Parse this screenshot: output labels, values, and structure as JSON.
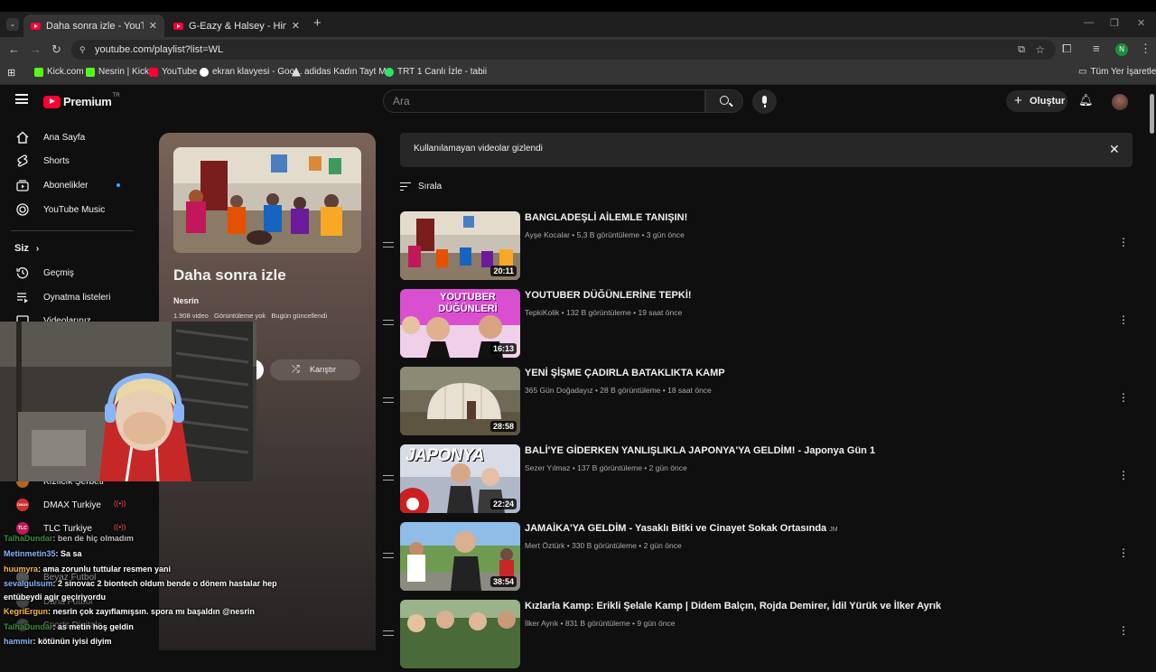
{
  "browser": {
    "tabs": [
      {
        "title": "Daha sonra izle - YouTube",
        "active": true
      },
      {
        "title": "G-Eazy & Halsey - Him & I (Lyri",
        "active": false
      }
    ],
    "new_tab_label": "+",
    "url": "youtube.com/playlist?list=WL",
    "profile_initial": "N",
    "bookmarks": [
      {
        "label": "Kick.com",
        "color": "#53fc18"
      },
      {
        "label": "Nesrin | Kick",
        "color": "#53fc18"
      },
      {
        "label": "YouTube",
        "color": "#ff0033"
      },
      {
        "label": "ekran klavyesi - Goo...",
        "color": "#ffffff"
      },
      {
        "label": "adidas Kadın Tayt M...",
        "color": "#dddddd"
      },
      {
        "label": "TRT 1 Canlı İzle - tabii",
        "color": "#2fe36b"
      }
    ],
    "all_bookmarks": "Tüm Yer İşaretleri"
  },
  "yt": {
    "logo_text": "Premium",
    "logo_region": "TR",
    "search_placeholder": "Ara",
    "create_label": "Oluştur",
    "sidebar": {
      "main": [
        {
          "label": "Ana Sayfa",
          "icon": "home-icon"
        },
        {
          "label": "Shorts",
          "icon": "shorts-icon"
        },
        {
          "label": "Abonelikler",
          "icon": "subscriptions-icon"
        },
        {
          "label": "YouTube Music",
          "icon": "music-icon"
        }
      ],
      "you_heading": "Siz",
      "you": [
        {
          "label": "Geçmiş",
          "icon": "history-icon"
        },
        {
          "label": "Oynatma listeleri",
          "icon": "playlists-icon"
        },
        {
          "label": "Videolarınız",
          "icon": "your-videos-icon"
        }
      ],
      "channels": [
        {
          "label": "Kızılcık Şerbeti",
          "color": "#b5651d"
        },
        {
          "label": "DMAX Turkiye",
          "color": "#d32f2f"
        },
        {
          "label": "TLC Turkiye",
          "color": "#c2185b"
        }
      ],
      "channels_hidden": [
        "Beyaz Futbol",
        "Daha Futbol",
        "Sports Digitale"
      ]
    },
    "playlist": {
      "title": "Daha sonra izle",
      "owner": "Nesrin",
      "stats": "1.908 video   Görüntüleme yok   Bugün güncellendi",
      "shuffle_label": "Karıştır"
    },
    "banner_text": "Kullanılamayan videolar gizlendi",
    "sort_label": "Sırala",
    "videos": [
      {
        "title": "BANGLADEŞLİ AİLEMLE TANIŞIN!",
        "meta": "Ayşe Kocalar • 5,3 B görüntüleme • 3 gün önce",
        "duration": "20:11"
      },
      {
        "title": "YOUTUBER DÜĞÜNLERİNE TEPKİ!",
        "meta": "TepkiKolik • 132 B görüntüleme • 19 saat önce",
        "duration": "16:13"
      },
      {
        "title": "YENİ ŞİŞME ÇADIRLA BATAKLIKTA KAMP",
        "meta": "365 Gün Doğadayız • 28 B görüntüleme • 18 saat önce",
        "duration": "28:58"
      },
      {
        "title": "BALİ'YE GİDERKEN YANLIŞLIKLA JAPONYA'YA GELDİM! - Japonya Gün 1",
        "meta": "Sezer Yılmaz • 137 B görüntüleme • 2 gün önce",
        "duration": "22:24"
      },
      {
        "title": "JAMAİKA'YA GELDİM - Yasaklı Bitki ve Cinayet Sokak Ortasında",
        "title_suffix": "JM",
        "meta": "Mert Öztürk • 330 B görüntüleme • 2 gün önce",
        "duration": "38:54"
      },
      {
        "title": "Kızlarla Kamp: Erikli Şelale Kamp | Didem Balçın, Rojda Demirer, İdil Yürük ve İlker Ayrık",
        "meta": "İlker Ayrık • 831 B görüntüleme • 9 gün önce",
        "duration": ""
      }
    ],
    "thumb_texts": {
      "v2": "YOUTUBER DÜĞÜNLERİ",
      "v4": "JAPONYA"
    }
  },
  "chat": [
    {
      "user": "TalhaDundar",
      "msg": ": ben de hiç olmadım",
      "color": "#3b8e3b"
    },
    {
      "user": "Metinmetin35",
      "msg": ": Sa sa",
      "color": "#8ab4f8"
    },
    {
      "user": "huumyra",
      "msg": ": ama zorunlu tuttular resmen yani",
      "color": "#ffb74d"
    },
    {
      "user": "sevalgulsum",
      "msg": ": 2 sinovac 2 biontech oldum bende o dönem hastalar hep",
      "color": "#8ab4f8"
    },
    {
      "user": "",
      "msg": "entübeydi agir geçiriyordu",
      "color": "#ffffff"
    },
    {
      "user": "KegriErgun",
      "msg": ": nesrin çok zayıflamışsın. spora mı başaldın @nesrin",
      "color": "#ffb74d"
    },
    {
      "user": "TalhaDundar",
      "msg": ": as metin hoş geldin",
      "color": "#3b8e3b"
    },
    {
      "user": "hammir",
      "msg": ": kötünün iyisi diyim",
      "color": "#8ab4f8"
    }
  ]
}
